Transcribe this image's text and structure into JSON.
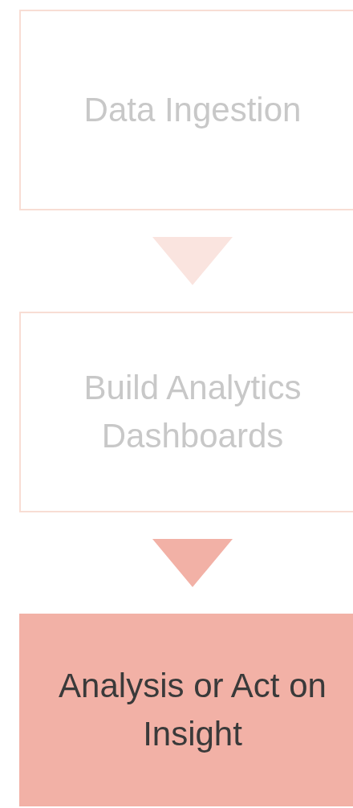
{
  "steps": [
    {
      "label": "Data Ingestion",
      "selected": false
    },
    {
      "label": "Build Analytics Dashboards",
      "selected": false
    },
    {
      "label": "Analysis or Act on Insight",
      "selected": true
    }
  ]
}
